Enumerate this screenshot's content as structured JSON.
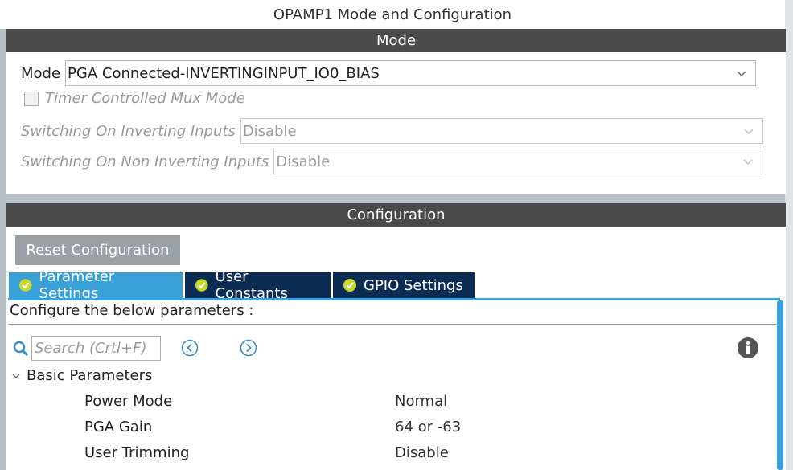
{
  "window": {
    "title": "OPAMP1 Mode and Configuration"
  },
  "mode_section": {
    "header": "Mode",
    "mode_label": "Mode",
    "mode_value": "PGA Connected-INVERTINGINPUT_IO0_BIAS",
    "timer_mux_label": "Timer Controlled Mux Mode",
    "timer_mux_checked": false,
    "switch_inv_label": "Switching On Inverting Inputs",
    "switch_inv_value": "Disable",
    "switch_noninv_label": "Switching On Non Inverting Inputs",
    "switch_noninv_value": "Disable"
  },
  "config_section": {
    "header": "Configuration",
    "reset_label": "Reset Configuration",
    "tabs": [
      {
        "label": "Parameter Settings",
        "active": true
      },
      {
        "label": "User Constants",
        "active": false
      },
      {
        "label": "GPIO Settings",
        "active": false
      }
    ],
    "instruction": "Configure the below parameters :",
    "search_placeholder": "Search (Crtl+F)",
    "group_label": "Basic Parameters",
    "params": [
      {
        "name": "Power Mode",
        "value": "Normal"
      },
      {
        "name": "PGA Gain",
        "value": "64 or -63"
      },
      {
        "name": "User Trimming",
        "value": "Disable"
      }
    ]
  },
  "colors": {
    "header_bg": "#4a4a4a",
    "tab_active": "#39a0d8",
    "tab_inactive": "#0c2c54",
    "tab_check": "#c6d92b",
    "button_bg": "#9aa0a5"
  },
  "icons": [
    "search-icon",
    "nav-prev-icon",
    "nav-next-icon",
    "info-icon",
    "chevron-down-icon",
    "check-circle-icon",
    "collapse-arrow-icon"
  ]
}
